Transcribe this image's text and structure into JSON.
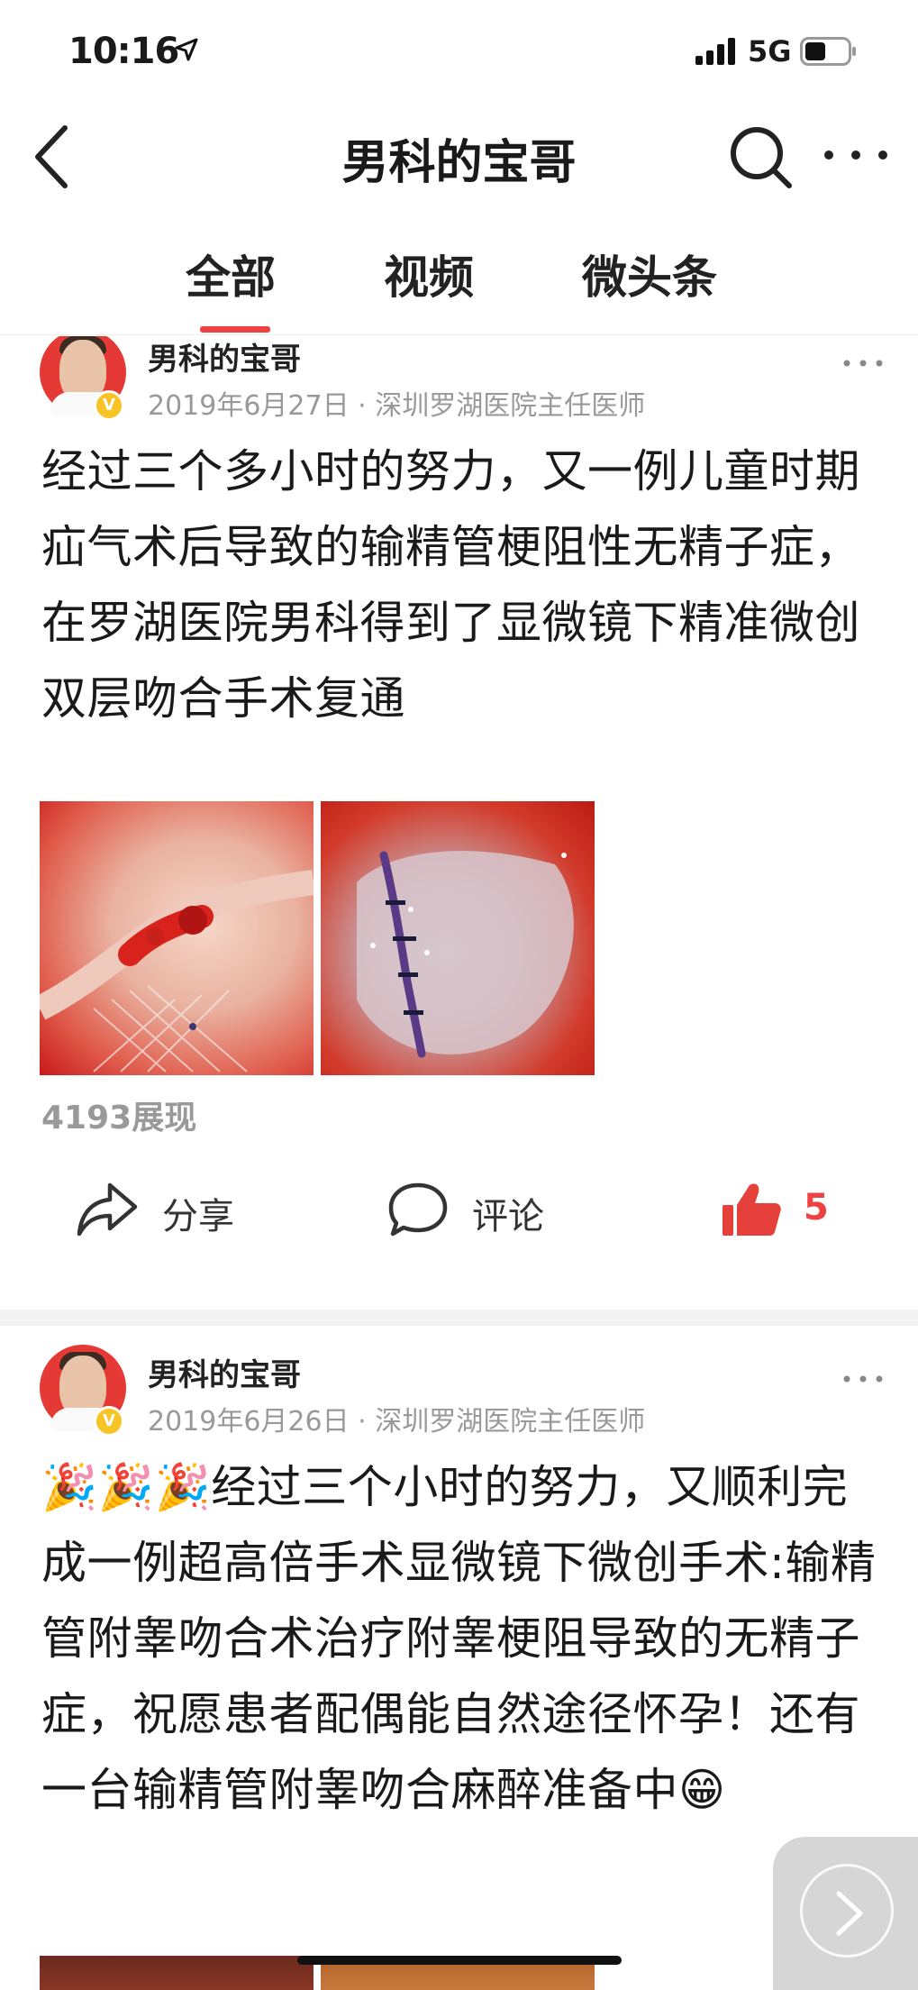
{
  "status_bar": {
    "time": "10:16",
    "network": "5G",
    "location_icon": "location-arrow-icon",
    "signal_icon": "cell-signal-icon",
    "battery_icon": "battery-icon"
  },
  "nav": {
    "title": "男科的宝哥",
    "back_icon": "chevron-left-icon",
    "search_icon": "search-icon",
    "more_icon": "more-horizontal-icon"
  },
  "tabs": {
    "items": [
      "全部",
      "视频",
      "微头条"
    ],
    "active": "全部",
    "accent_color": "#f04142"
  },
  "posts": [
    {
      "author": "男科的宝哥",
      "date": "2019年6月27日",
      "source": "深圳罗湖医院主任医师",
      "separator": "·",
      "text": "经过三个多小时的努力，又一例儿童时期疝气术后导致的输精管梗阻性无精子症，在罗湖医院男科得到了显微镜下精准微创双层吻合手术复通",
      "views": "4193展现",
      "actions": {
        "share": "分享",
        "comment": "评论",
        "likes": "5"
      }
    },
    {
      "author": "男科的宝哥",
      "date": "2019年6月26日",
      "source": "深圳罗湖医院主任医师",
      "separator": "·",
      "text": "🎉🎉🎉经过三个小时的努力，又顺利完成一例超高倍手术显微镜下微创手术:输精管附睾吻合术治疗附睾梗阻导致的无精子症，祝愿患者配偶能自然途径怀孕！还有一台输精管附睾吻合麻醉准备中😁"
    }
  ],
  "colors": {
    "like_red": "#f04142",
    "meta_gray": "#999999",
    "divider": "#f3f3f3",
    "verified_badge": "#f7c325"
  }
}
